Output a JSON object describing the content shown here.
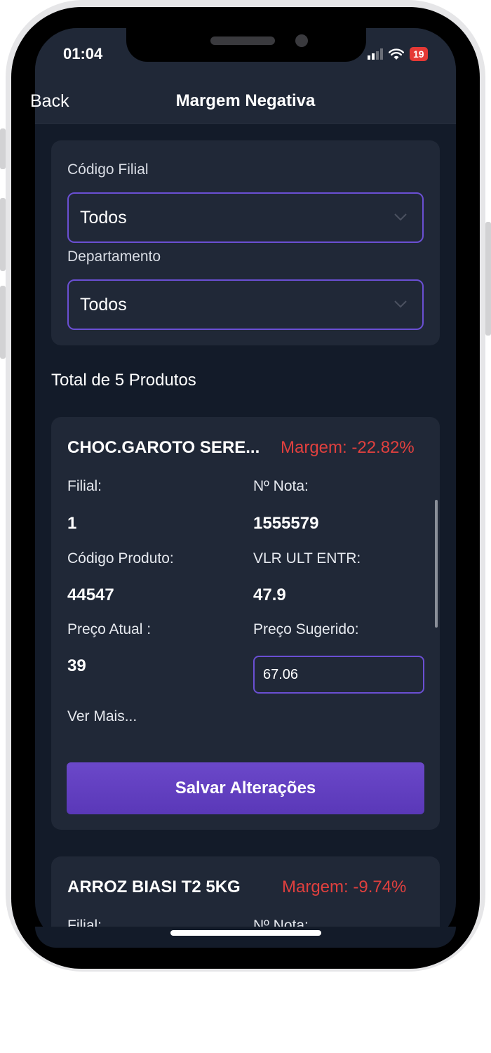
{
  "status_bar": {
    "time": "01:04",
    "battery": "19"
  },
  "header": {
    "back_label": "Back",
    "title": "Margem Negativa"
  },
  "filters": {
    "filial_label": "Código Filial",
    "filial_value": "Todos",
    "departamento_label": "Departamento",
    "departamento_value": "Todos"
  },
  "total_text": "Total de 5 Produtos",
  "labels": {
    "filial": "Filial:",
    "nota": "Nº Nota:",
    "codigo_produto": "Código Produto:",
    "vlr_ult_entr": "VLR ULT ENTR:",
    "preco_atual": "Preço Atual :",
    "preco_sugerido": "Preço Sugerido:",
    "ver_mais": "Ver Mais...",
    "save": "Salvar Alterações"
  },
  "products": [
    {
      "name": "CHOC.GAROTO SERE...",
      "margin": "Margem: -22.82%",
      "filial": "1",
      "nota": "1555579",
      "codigo_produto": "44547",
      "vlr_ult_entr": "47.9",
      "preco_atual": "39",
      "preco_sugerido": "67.06"
    },
    {
      "name": "ARROZ BIASI T2 5KG",
      "margin": "Margem: -9.74%"
    }
  ],
  "colors": {
    "background": "#131b29",
    "card": "#202837",
    "accent": "#6a4fd3",
    "negative": "#e0403e"
  }
}
